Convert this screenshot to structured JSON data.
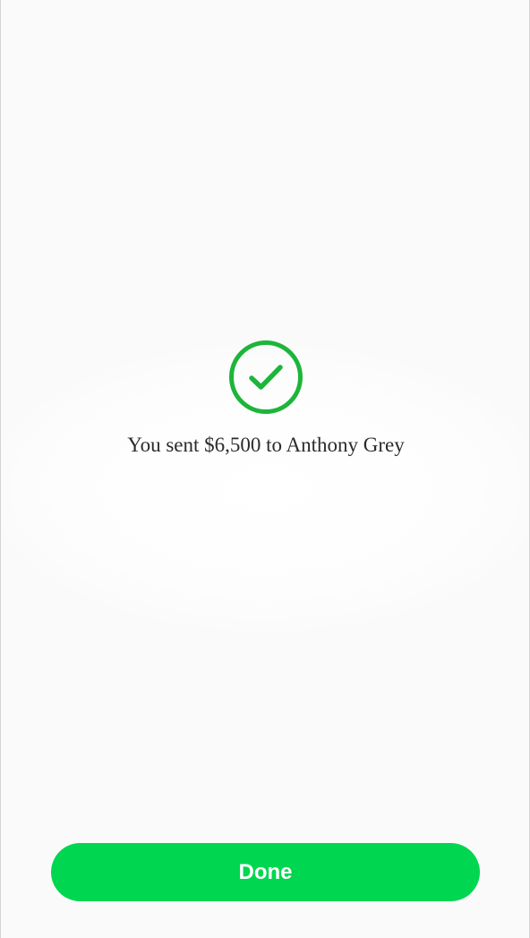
{
  "confirmation": {
    "icon": "checkmark-circle-icon",
    "message": "You sent $6,500 to Anthony Grey"
  },
  "actions": {
    "done_label": "Done"
  },
  "colors": {
    "accent": "#00d64f",
    "icon_green": "#1db53a",
    "text": "#2b2b2b",
    "background": "#fcfcfc"
  }
}
